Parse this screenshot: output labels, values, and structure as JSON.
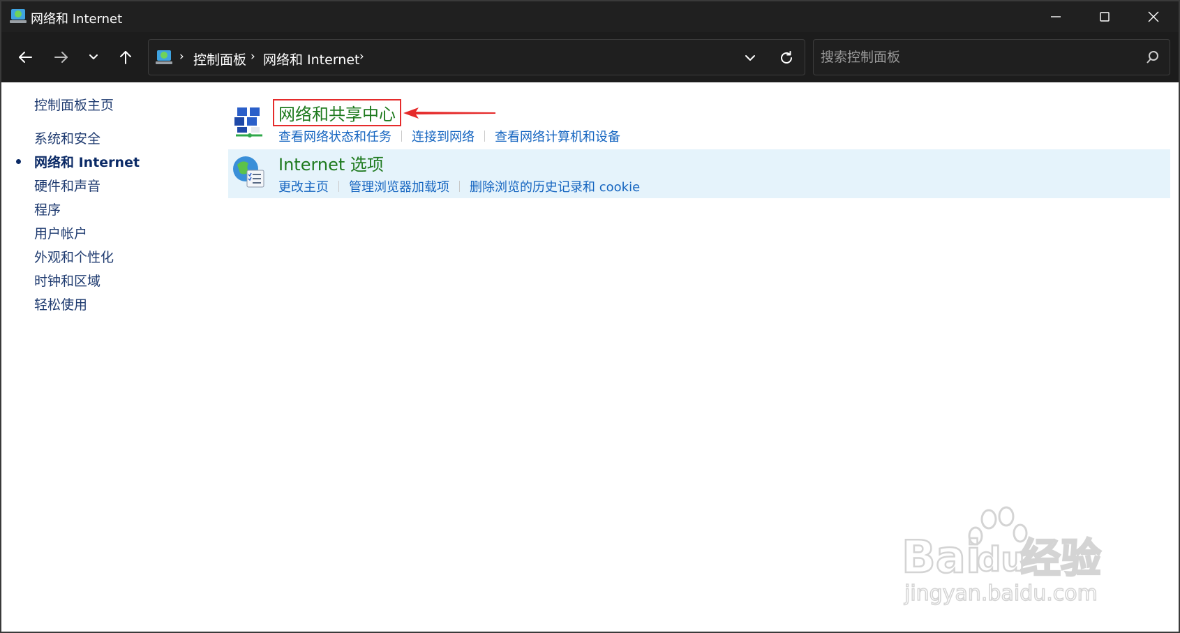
{
  "window": {
    "title": "网络和 Internet"
  },
  "navigation": {
    "breadcrumbs": [
      "控制面板",
      "网络和 Internet"
    ],
    "search_placeholder": "搜索控制面板"
  },
  "sidebar": {
    "items": [
      {
        "label": "控制面板主页",
        "active": false
      },
      {
        "label": "系统和安全",
        "active": false
      },
      {
        "label": "网络和 Internet",
        "active": true
      },
      {
        "label": "硬件和声音",
        "active": false
      },
      {
        "label": "程序",
        "active": false
      },
      {
        "label": "用户帐户",
        "active": false
      },
      {
        "label": "外观和个性化",
        "active": false
      },
      {
        "label": "时钟和区域",
        "active": false
      },
      {
        "label": "轻松使用",
        "active": false
      }
    ]
  },
  "main": {
    "categories": [
      {
        "title": "网络和共享中心",
        "links": [
          "查看网络状态和任务",
          "连接到网络",
          "查看网络计算机和设备"
        ]
      },
      {
        "title": "Internet 选项",
        "links": [
          "更改主页",
          "管理浏览器加载项",
          "删除浏览的历史记录和 cookie"
        ]
      }
    ]
  },
  "watermark": {
    "brand": "Bai",
    "brand2": "du",
    "brand3": "经验",
    "url": "jingyan.baidu.com"
  },
  "colors": {
    "titlebar": "#202020",
    "category_title": "#1e7a1e",
    "link": "#1565c0",
    "highlight_box": "#e52b2b",
    "hover_bg": "#e5f3fb"
  }
}
